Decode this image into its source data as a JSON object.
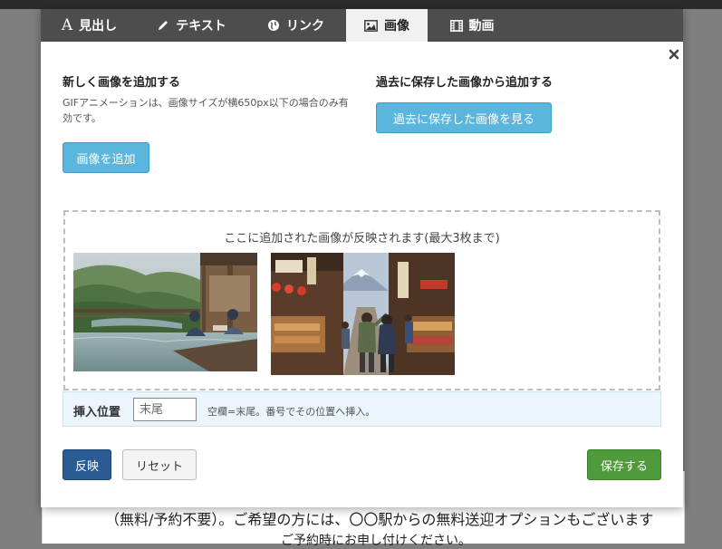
{
  "tabs": [
    {
      "label": "見出し",
      "icon": "heading-icon",
      "glyph": "A"
    },
    {
      "label": "テキスト",
      "icon": "pencil-icon"
    },
    {
      "label": "リンク",
      "icon": "globe-icon"
    },
    {
      "label": "画像",
      "icon": "image-icon",
      "active": true
    },
    {
      "label": "動画",
      "icon": "film-icon"
    }
  ],
  "add_new": {
    "heading": "新しく画像を追加する",
    "note": "GIFアニメーションは、画像サイズが横650px以下の場合のみ有効です。",
    "button": "画像を追加"
  },
  "past": {
    "heading": "過去に保存した画像から追加する",
    "button": "過去に保存した画像を見る"
  },
  "dropzone": {
    "caption": "ここに追加された画像が反映されます(最大3枚まで)",
    "images": [
      "hot-spring-onsen-photo",
      "shopping-street-mount-fuji-photo"
    ]
  },
  "insert": {
    "label": "挿入位置",
    "placeholder": "末尾",
    "value": "",
    "hint": "空欄=末尾。番号でその位置へ挿入。"
  },
  "actions": {
    "apply": "反映",
    "reset": "リセット",
    "save": "保存する"
  },
  "background_text": {
    "line1": "（無料/予約不要）。ご希望の方には、〇〇駅からの無料送迎オプションもございます",
    "line2": "ご予約時にお申し付けください。"
  },
  "colors": {
    "tab_bar": "#4d4d4d",
    "primary_button": "#5bb6dd",
    "apply_button": "#2a5b93",
    "save_button": "#4f9a3a",
    "insert_bg": "#eaf5fc"
  }
}
